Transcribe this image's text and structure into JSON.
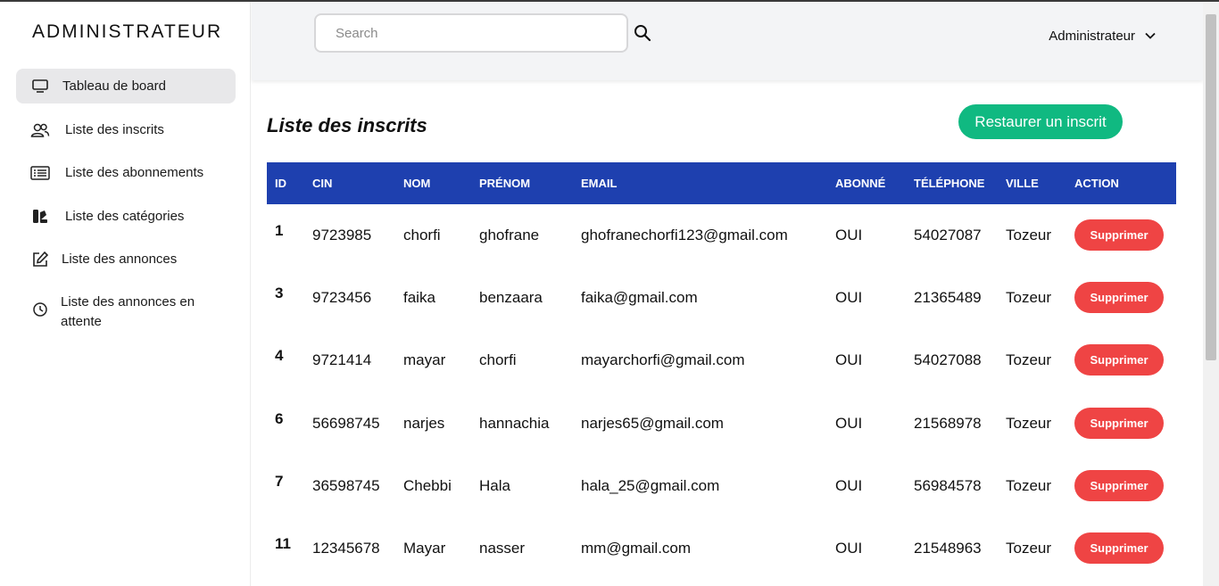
{
  "sidebar": {
    "brand": "ADMINISTRATEUR",
    "items": [
      {
        "label": "Tableau de board",
        "icon": "monitor-icon",
        "active": true
      },
      {
        "label": "Liste des inscrits",
        "icon": "users-icon"
      },
      {
        "label": "Liste des abonnements",
        "icon": "list-card-icon"
      },
      {
        "label": "Liste des catégories",
        "icon": "categories-icon"
      },
      {
        "label": "Liste des annonces",
        "icon": "edit-icon"
      },
      {
        "label": "Liste des annonces en",
        "label2": "attente",
        "icon": "clock-icon"
      }
    ]
  },
  "header": {
    "search_placeholder": "Search",
    "search_icon": "search-icon",
    "user_label": "Administrateur"
  },
  "main": {
    "title": "Liste des inscrits",
    "restore_label": "Restaurer un inscrit",
    "columns": [
      "ID",
      "CIN",
      "NOM",
      "PRÉNOM",
      "EMAIL",
      "ABONNÉ",
      "TÉLÉPHONE",
      "VILLE",
      "ACTION"
    ],
    "delete_label": "Supprimer",
    "rows": [
      {
        "id": "1",
        "cin": "9723985",
        "nom": "chorfi",
        "prenom": "ghofrane",
        "email": "ghofranechorfi123@gmail.com",
        "abonne": "OUI",
        "tel": "54027087",
        "ville": "Tozeur"
      },
      {
        "id": "3",
        "cin": "9723456",
        "nom": "faika",
        "prenom": "benzaara",
        "email": "faika@gmail.com",
        "abonne": "OUI",
        "tel": "21365489",
        "ville": "Tozeur"
      },
      {
        "id": "4",
        "cin": "9721414",
        "nom": "mayar",
        "prenom": "chorfi",
        "email": "mayarchorfi@gmail.com",
        "abonne": "OUI",
        "tel": "54027088",
        "ville": "Tozeur"
      },
      {
        "id": "6",
        "cin": "56698745",
        "nom": "narjes",
        "prenom": "hannachia",
        "email": "narjes65@gmail.com",
        "abonne": "OUI",
        "tel": "21568978",
        "ville": "Tozeur"
      },
      {
        "id": "7",
        "cin": "36598745",
        "nom": "Chebbi",
        "prenom": "Hala",
        "email": "hala_25@gmail.com",
        "abonne": "OUI",
        "tel": "56984578",
        "ville": "Tozeur"
      },
      {
        "id": "11",
        "cin": "12345678",
        "nom": "Mayar",
        "prenom": "nasser",
        "email": "mm@gmail.com",
        "abonne": "OUI",
        "tel": "21548963",
        "ville": "Tozeur"
      }
    ]
  },
  "colors": {
    "header_bg": "#f3f4f6",
    "table_head": "#1e40af",
    "restore": "#10b981",
    "delete": "#ef4444",
    "active_nav": "#e8e8ea"
  }
}
